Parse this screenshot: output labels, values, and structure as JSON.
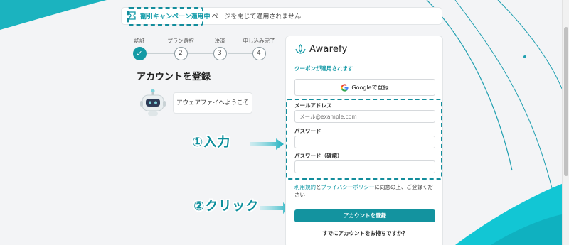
{
  "banner": {
    "highlight": "割引キャンペーン適用中",
    "text": "ページを閉じて適用されません"
  },
  "steps": [
    {
      "label": "認証",
      "num": "✓",
      "done": true
    },
    {
      "label": "プラン選択",
      "num": "2",
      "done": false
    },
    {
      "label": "決済",
      "num": "3",
      "done": false
    },
    {
      "label": "申し込み完了",
      "num": "4",
      "done": false
    }
  ],
  "page_title": "アカウントを登録",
  "welcome": "アウェアファイへようこそ",
  "card": {
    "brand": "Awarefy",
    "coupon_text": "クーポンが適用されます",
    "google_button": "Googleで登録",
    "email_label": "メールアドレス",
    "email_placeholder": "メール@example.com",
    "email_value": "",
    "password_label": "パスワード",
    "password_value": "",
    "password_confirm_label": "パスワード（確認）",
    "password_confirm_value": "",
    "terms_link": "利用規約",
    "terms_and": "と",
    "privacy_link": "プライバシーポリシー",
    "terms_suffix": "に同意の上、ご登録ください",
    "submit_button": "アカウントを登録",
    "login_question": "すでにアカウントをお持ちですか？"
  },
  "annotations": {
    "step1": "①入力",
    "step2": "②クリック"
  },
  "colors": {
    "accent": "#13939f",
    "annotation": "#0d8f9c",
    "background": "#f3f4f6"
  }
}
